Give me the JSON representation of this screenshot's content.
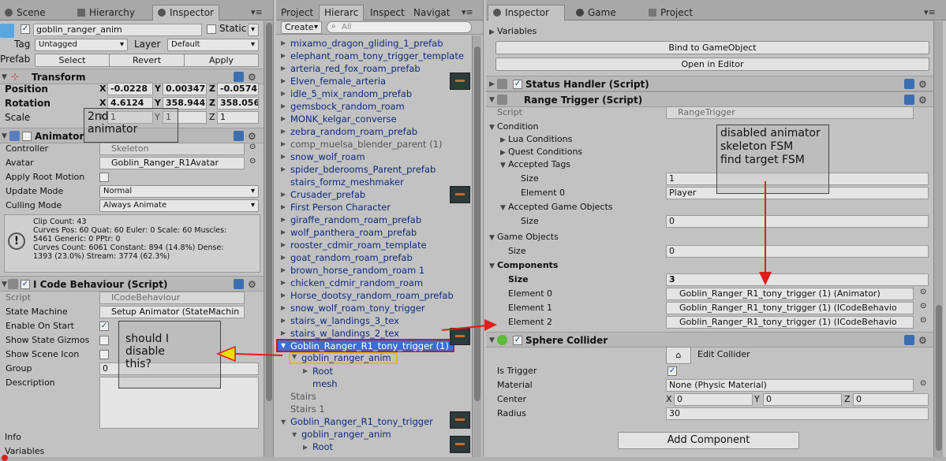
{
  "left_panel": {
    "tabs": [
      "Scene",
      "Hierarchy",
      "Inspector"
    ],
    "object": {
      "name": "goblin_ranger_anim",
      "static_label": "Static",
      "tag_label": "Tag",
      "tag_value": "Untagged",
      "layer_label": "Layer",
      "layer_value": "Default",
      "prefab_label": "Prefab",
      "prefab_buttons": [
        "Select",
        "Revert",
        "Apply"
      ]
    },
    "transform": {
      "title": "Transform",
      "position_label": "Position",
      "rotation_label": "Rotation",
      "scale_label": "Scale",
      "position": [
        "-0.0228",
        "0.00347",
        "-0.0574"
      ],
      "rotation": [
        "4.6124",
        "358.944",
        "358.056"
      ],
      "scale": [
        "1",
        "1",
        "1"
      ],
      "axes": [
        "X",
        "Y",
        "Z"
      ]
    },
    "animator": {
      "title": "Animator",
      "controller_label": "Controller",
      "controller_value": "Skeleton",
      "avatar_label": "Avatar",
      "avatar_value": "Goblin_Ranger_R1Avatar",
      "apply_root_motion_label": "Apply Root Motion",
      "update_mode_label": "Update Mode",
      "update_mode_value": "Normal",
      "culling_mode_label": "Culling Mode",
      "culling_mode_value": "Always Animate",
      "info_lines": [
        "Clip Count: 43",
        "Curves Pos: 60 Quat: 60 Euler: 0 Scale: 60 Muscles:",
        "5461 Generic: 0 PPtr: 0",
        "Curves Count: 6061 Constant: 894 (14.8%) Dense:",
        "1393 (23.0%) Stream: 3774 (62.3%)"
      ]
    },
    "icode": {
      "title": "I Code Behaviour (Script)",
      "script_label": "Script",
      "script_value": "ICodeBehaviour",
      "state_machine_label": "State Machine",
      "state_machine_value": "Setup Animator (StateMachin",
      "enable_on_start_label": "Enable On Start",
      "show_state_gizmos_label": "Show State Gizmos",
      "show_scene_icon_label": "Show Scene Icon",
      "group_label": "Group",
      "group_value": "0",
      "description_label": "Description"
    },
    "footer": [
      "Info",
      "Variables"
    ],
    "annotation_scale": "2nd\nanimator",
    "annotation_disable": "should I\ndisable\nthis?"
  },
  "middle_panel": {
    "tabs": [
      "Project",
      "Hierarc",
      "Inspect",
      "Navigat"
    ],
    "create_label": "Create",
    "search_placeholder": "All",
    "items": [
      {
        "text": "mixamo_dragon_gliding_1_prefab",
        "arrow": true,
        "gray": false
      },
      {
        "text": "elephant_roam_tony_trigger_template",
        "arrow": true,
        "gray": false
      },
      {
        "text": "arteria_red_fox_roam_prefab",
        "arrow": true,
        "gray": false
      },
      {
        "text": "Elven_female_arteria",
        "arrow": true,
        "gray": false
      },
      {
        "text": "idle_5_mix_random_prefab",
        "arrow": true,
        "gray": false
      },
      {
        "text": "gemsbock_random_roam",
        "arrow": true,
        "gray": false
      },
      {
        "text": "MONK_kelgar_converse",
        "arrow": true,
        "gray": false
      },
      {
        "text": "zebra_random_roam_prefab",
        "arrow": true,
        "gray": false
      },
      {
        "text": "comp_muelsa_blender_parent (1)",
        "arrow": true,
        "gray": true
      },
      {
        "text": "snow_wolf_roam",
        "arrow": true,
        "gray": false
      },
      {
        "text": "spider_bderooms_Parent_prefab",
        "arrow": true,
        "gray": false
      },
      {
        "text": "stairs_formz_meshmaker",
        "arrow": false,
        "gray": false
      },
      {
        "text": "Crusader_prefab",
        "arrow": true,
        "gray": false
      },
      {
        "text": "First Person Character",
        "arrow": true,
        "gray": false
      },
      {
        "text": "giraffe_random_roam_prefab",
        "arrow": true,
        "gray": false
      },
      {
        "text": "wolf_panthera_roam_prefab",
        "arrow": true,
        "gray": false
      },
      {
        "text": "rooster_cdmir_roam_template",
        "arrow": true,
        "gray": false
      },
      {
        "text": "goat_random_roam_prefab",
        "arrow": true,
        "gray": false
      },
      {
        "text": "brown_horse_random_roam 1",
        "arrow": true,
        "gray": false
      },
      {
        "text": "chicken_cdmir_random_roam",
        "arrow": true,
        "gray": false
      },
      {
        "text": "Horse_dootsy_random_roam_prefab",
        "arrow": true,
        "gray": false
      },
      {
        "text": "snow_wolf_roam_tony_trigger",
        "arrow": true,
        "gray": false
      },
      {
        "text": "stairs_w_landings_3_tex",
        "arrow": true,
        "gray": false
      },
      {
        "text": "stairs_w_landings_2_tex",
        "arrow": true,
        "gray": false
      }
    ],
    "selected_item": "Goblin_Ranger_R1_tony_trigger (1)",
    "child_item": "goblin_ranger_anim",
    "grandchildren": [
      "Root",
      "mesh"
    ],
    "after_items": [
      "Stairs",
      "Stairs 1"
    ],
    "second_item": "Goblin_Ranger_R1_tony_trigger",
    "second_child": "goblin_ranger_anim",
    "second_grandchild": "Root"
  },
  "right_panel": {
    "tabs": [
      "Inspector",
      "Game",
      "Project"
    ],
    "variables_label": "Variables",
    "bind_button": "Bind to GameObject",
    "open_editor_button": "Open in Editor",
    "status_handler_title": "Status Handler (Script)",
    "range_trigger_title": "Range Trigger (Script)",
    "script_label": "Script",
    "script_value": "RangeTrigger",
    "condition_label": "Condition",
    "lua_conditions": "Lua Conditions",
    "quest_conditions": "Quest Conditions",
    "accepted_tags": "Accepted Tags",
    "size_label": "Size",
    "tags_size": "1",
    "element0_label": "Element 0",
    "tags_element0": "Player",
    "accepted_game_objects": "Accepted Game Objects",
    "ago_size": "0",
    "game_objects_label": "Game Objects",
    "go_size": "0",
    "components_label": "Components",
    "components_size": "3",
    "component_elements": [
      {
        "label": "Element 0",
        "value": "Goblin_Ranger_R1_tony_trigger (1) (Animator)"
      },
      {
        "label": "Element 1",
        "value": "Goblin_Ranger_R1_tony_trigger (1) (ICodeBehavio"
      },
      {
        "label": "Element 2",
        "value": "Goblin_Ranger_R1_tony_trigger (1) (ICodeBehavio"
      }
    ],
    "sphere_collider_title": "Sphere Collider",
    "edit_collider_label": "Edit Collider",
    "is_trigger_label": "Is Trigger",
    "material_label": "Material",
    "material_value": "None (Physic Material)",
    "center_label": "Center",
    "center_values": [
      "0",
      "0",
      "0"
    ],
    "axes": [
      "X",
      "Y",
      "Z"
    ],
    "radius_label": "Radius",
    "radius_value": "30",
    "add_component_button": "Add Component",
    "annotation": "disabled animator\nskeleton FSM\nfind target FSM"
  },
  "colors": {
    "selection": "#3e6bd6",
    "arrow_red": "#e21b1b",
    "annotation_yellow": "#f5e000"
  }
}
